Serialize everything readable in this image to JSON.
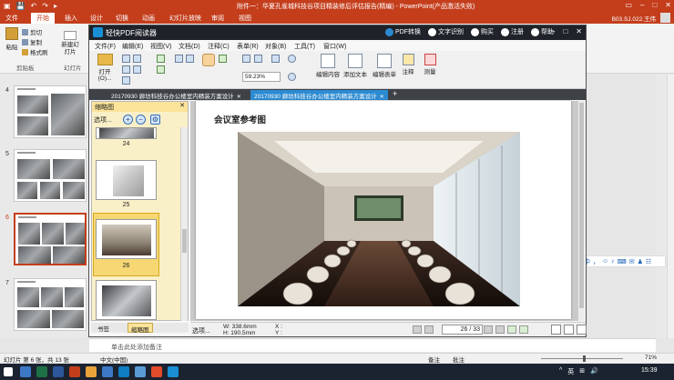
{
  "ppt": {
    "window_title": "附件一：华夏孔雀城科技谷项目精装修后评估报告(精编) - PowerPoint(产品激活失败)",
    "tabs": [
      "文件",
      "开始",
      "插入",
      "设计",
      "切换",
      "动画",
      "幻灯片放映",
      "审阅",
      "视图"
    ],
    "user": "B03.SJ.022.王伟",
    "ribbon": {
      "paste": "粘贴",
      "cut": "剪切",
      "copy": "复制",
      "format_painter": "格式刷",
      "new_slide": "新建幻灯片",
      "clipboard_group": "剪贴板",
      "slides_group": "幻灯片"
    },
    "slide_numbers": [
      "4",
      "5",
      "6",
      "7"
    ],
    "notes_placeholder": "单击此处添加备注",
    "status": {
      "slide_info": "幻灯片 第 6 张，共 13 张",
      "language": "中文(中国)",
      "notes": "备注",
      "comments": "批注",
      "zoom": "71%"
    }
  },
  "pdf": {
    "app_name": "轻快PDF阅读器",
    "title_actions": [
      "PDF转换",
      "文字识别",
      "购买",
      "注册",
      "帮助"
    ],
    "menu": [
      "文件(F)",
      "编辑(E)",
      "视图(V)",
      "文档(D)",
      "注释(C)",
      "表单(R)",
      "对象(B)",
      "工具(T)",
      "窗口(W)"
    ],
    "toolbar": {
      "open": "打开(O)...",
      "zoom": "59.23%",
      "edit_content": "编辑内容",
      "add_text": "添加文本",
      "edit_form": "编辑表单",
      "annotate": "注释",
      "measure": "测量"
    },
    "doc_tabs": [
      "20170930 廊坊科技谷办公楼室内精装方案设计",
      "20170930 廊坊科技谷办公楼室内精装方案设计"
    ],
    "panel": {
      "title": "缩略图",
      "options": "选项...",
      "page_labels": [
        "24",
        "25",
        "26"
      ],
      "tab_bookmarks": "书签",
      "tab_thumbnails": "缩略图"
    },
    "page_heading": "会议室参考图",
    "status": {
      "select": "选项...",
      "width": "W: 338.6mm",
      "height": "H: 190.5mm",
      "x": "X :",
      "y": "Y :",
      "page_input": "26",
      "page_total": "/ 33"
    }
  },
  "ime": [
    "中",
    "，",
    "☺",
    "♪",
    "⌨",
    "✉",
    "♟",
    "☷"
  ],
  "taskbar": {
    "tray": [
      "^",
      "英",
      "⊞",
      "🔊"
    ],
    "time": "15:39"
  },
  "colors": {
    "ppt_accent": "#c43e1c",
    "pdf_titlebar": "#1f2329",
    "pdf_tab_active": "#2c8ad1",
    "thumb_panel": "#faf0c8"
  }
}
